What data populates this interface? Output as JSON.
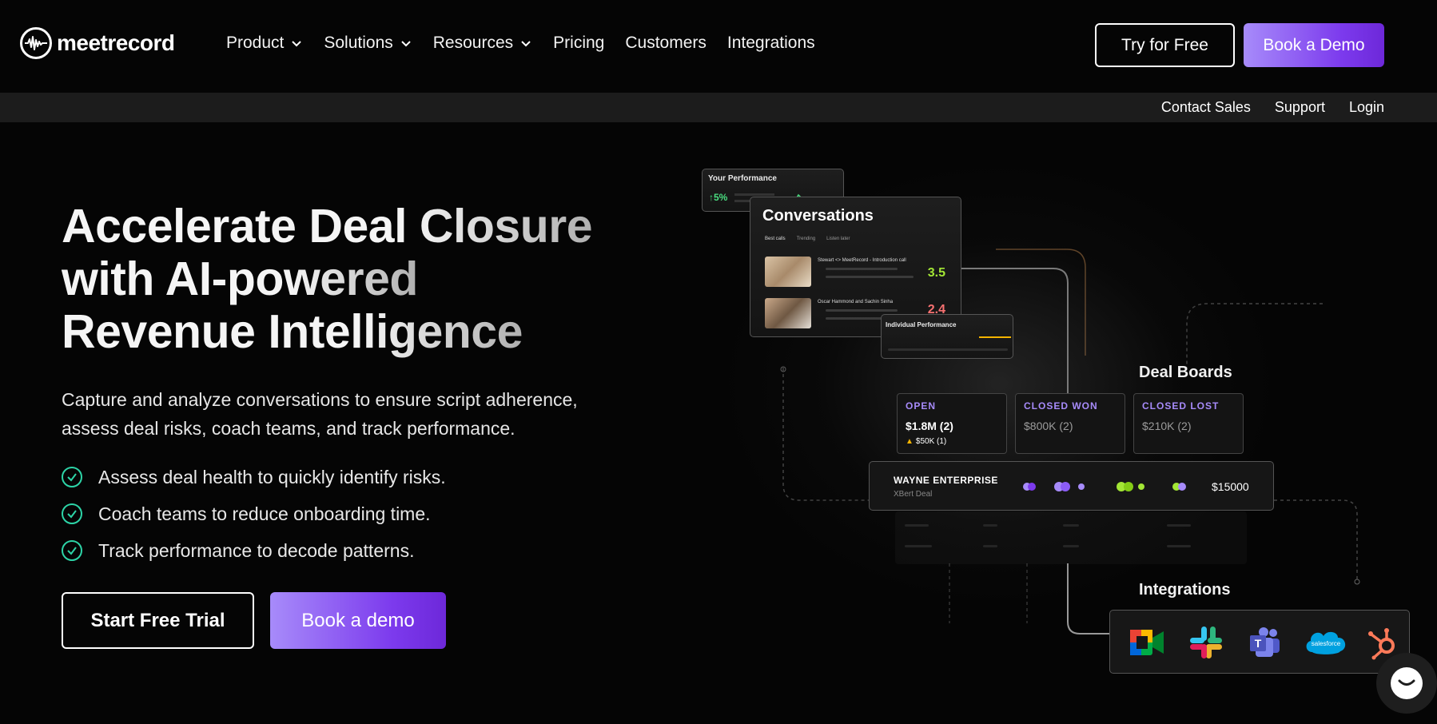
{
  "nav": {
    "logo_text": "meetrecord",
    "menu": [
      {
        "label": "Product",
        "has_dropdown": true
      },
      {
        "label": "Solutions",
        "has_dropdown": true
      },
      {
        "label": "Resources",
        "has_dropdown": true
      },
      {
        "label": "Pricing",
        "has_dropdown": false
      },
      {
        "label": "Customers",
        "has_dropdown": false
      },
      {
        "label": "Integrations",
        "has_dropdown": false
      }
    ],
    "try_free_label": "Try for Free",
    "book_demo_label": "Book a Demo"
  },
  "subnav": {
    "contact_sales": "Contact Sales",
    "support": "Support",
    "login": "Login"
  },
  "hero": {
    "title_lines": [
      "Accelerate Deal Closure",
      "with AI-powered",
      "Revenue Intelligence"
    ],
    "description_lines": [
      "Capture and analyze conversations to ensure script adherence,",
      "assess deal risks, coach teams, and track performance."
    ],
    "bullets": [
      "Assess deal health to quickly identify risks.",
      "Coach teams to reduce onboarding time.",
      "Track performance to decode patterns."
    ],
    "start_trial_label": "Start Free Trial",
    "book_demo_label": "Book a demo"
  },
  "illustration": {
    "performance": {
      "title": "Your Performance",
      "value": "↑5%"
    },
    "conversations": {
      "title": "Conversations",
      "tabs": [
        "Best calls",
        "Trending",
        "Listen later"
      ],
      "rows": [
        {
          "title": "Stewart <> MeetRecord - Introduction call",
          "score": "3.5",
          "score_color": "#a3e635"
        },
        {
          "title": "Oscar Hammond and Sachin Sinha",
          "score": "2.4",
          "score_color": "#f87171"
        }
      ]
    },
    "individual_performance": {
      "title": "Individual Performance"
    },
    "deal_boards": {
      "title": "Deal Boards",
      "stages": [
        {
          "label": "OPEN",
          "value": "$1.8M (2)",
          "warning": "$50K (1)"
        },
        {
          "label": "CLOSED WON",
          "value": "$800K (2)"
        },
        {
          "label": "CLOSED LOST",
          "value": "$210K (2)"
        }
      ],
      "deal": {
        "name": "WAYNE ENTERPRISE",
        "subtitle": "XBert Deal",
        "amount": "$15000"
      }
    },
    "integrations": {
      "title": "Integrations",
      "apps": [
        "google-meet-icon",
        "slack-icon",
        "teams-icon",
        "salesforce-icon",
        "hubspot-icon"
      ],
      "salesforce_label": "salesforce"
    }
  },
  "colors": {
    "accent_purple": "#7c3aed",
    "accent_light_purple": "#a78bfa",
    "check_green": "#2dd4a7"
  }
}
